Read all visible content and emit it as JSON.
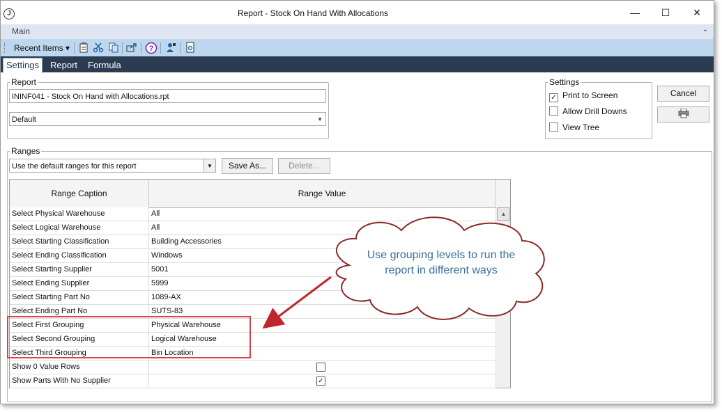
{
  "window": {
    "title": "Report - Stock On Hand With Allocations",
    "app_icon": "J"
  },
  "title_buttons": {
    "minimize": "—",
    "maximize": "☐",
    "close": "✕"
  },
  "menubar": {
    "main_label": "Main",
    "chevron": "⌄"
  },
  "toolbar": {
    "recent_items": "Recent Items ▾"
  },
  "tabs": {
    "settings": "Settings",
    "report": "Report",
    "formula": "Formula"
  },
  "report_group": {
    "legend": "Report",
    "report_file": "ININF041 - Stock On Hand with Allocations.rpt",
    "layout_value": "Default"
  },
  "settings_group": {
    "legend": "Settings",
    "print_to_screen": {
      "label": "Print to Screen",
      "checked": "✓"
    },
    "allow_drill_downs": {
      "label": "Allow Drill Downs",
      "checked": ""
    },
    "view_tree": {
      "label": "View Tree",
      "checked": ""
    }
  },
  "buttons": {
    "cancel": "Cancel"
  },
  "ranges_group": {
    "legend": "Ranges",
    "preset_value": "Use the default ranges for this report",
    "save_as": "Save As...",
    "delete": "Delete..."
  },
  "grid": {
    "col_caption": "Range Caption",
    "col_value": "Range Value",
    "rows": [
      {
        "caption": "Select Physical Warehouse",
        "value": "All"
      },
      {
        "caption": "Select Logical Warehouse",
        "value": "All"
      },
      {
        "caption": "Select Starting Classification",
        "value": "Building Accessories"
      },
      {
        "caption": "Select Ending Classification",
        "value": "Windows"
      },
      {
        "caption": "Select Starting Supplier",
        "value": "5001"
      },
      {
        "caption": "Select Ending Supplier",
        "value": "5999"
      },
      {
        "caption": "Select Starting Part No",
        "value": "1089-AX"
      },
      {
        "caption": "Select Ending Part No",
        "value": "SUTS-83"
      },
      {
        "caption": "Select First Grouping",
        "value": "Physical Warehouse"
      },
      {
        "caption": "Select Second Grouping",
        "value": "Logical Warehouse"
      },
      {
        "caption": "Select Third Grouping",
        "value": "Bin Location"
      },
      {
        "caption": "Show 0 Value Rows",
        "value": ""
      },
      {
        "caption": "Show Parts With No Supplier",
        "value": ""
      }
    ],
    "show_zero_checked": "",
    "show_no_supplier_checked": "✓"
  },
  "callout": {
    "text": "Use grouping levels to run the report in different ways"
  },
  "colors": {
    "tab_bar": "#2b3b52",
    "toolbar": "#bdd7ee",
    "menubar": "#dfe6f1",
    "highlight": "#d9434a",
    "callout_text": "#3b6e9f"
  }
}
